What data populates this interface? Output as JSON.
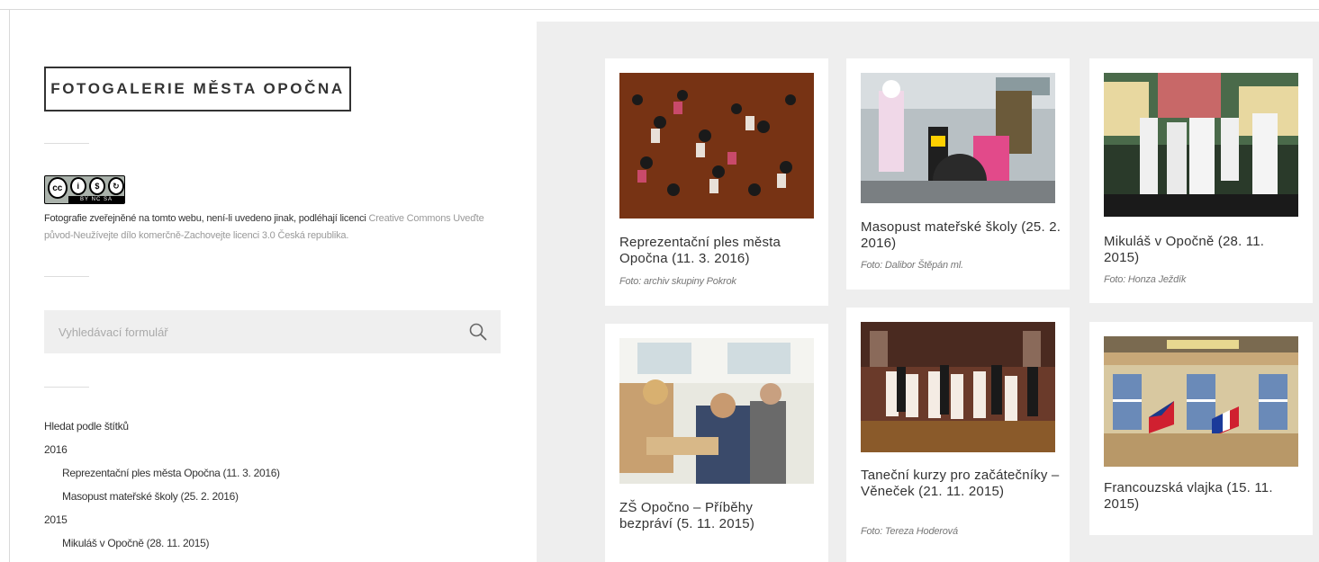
{
  "site": {
    "title": "FOTOGALERIE MĚSTA OPOČNA"
  },
  "license": {
    "badge_text": "BY NC SA",
    "text_prefix": "Fotografie zveřejněné na tomto webu, není-li uvedeno jinak, podléhají licenci ",
    "link_text": "Creative Commons Uveďte původ-Neužívejte dílo komerčně-Zachovejte licenci 3.0 Česká republika."
  },
  "search": {
    "placeholder": "Vyhledávací formulář"
  },
  "tags": {
    "heading": "Hledat podle štítků",
    "groups": [
      {
        "year": "2016",
        "items": [
          "Reprezentační ples města Opočna (11. 3. 2016)",
          "Masopust mateřské školy (25. 2. 2016)"
        ]
      },
      {
        "year": "2015",
        "items": [
          "Mikuláš v Opočně (28. 11. 2015)"
        ]
      }
    ]
  },
  "gallery": {
    "cards": [
      {
        "title": "Reprezentační ples města Opočna (11. 3. 2016)",
        "credit": "Foto: archiv skupiny Pokrok",
        "photo_icon": "ballroom-dance-photo"
      },
      {
        "title": "Masopust mateřské školy (25. 2. 2016)",
        "credit": "Foto: Dalibor Štěpán ml.",
        "photo_icon": "carnival-kids-photo"
      },
      {
        "title": "Mikuláš v Opočně (28. 11. 2015)",
        "credit": "Foto: Honza Ježdík",
        "photo_icon": "stage-performance-photo"
      },
      {
        "title": "ZŠ Opočno – Příběhy bezpráví (5. 11. 2015)",
        "credit": "",
        "photo_icon": "classroom-photo"
      },
      {
        "title": "Taneční kurzy pro začátečníky – Věneček (21. 11. 2015)",
        "credit": "Foto: Tereza Hoderová",
        "photo_icon": "dance-course-photo"
      },
      {
        "title": "Francouzská vlajka (15. 11. 2015)",
        "credit": "",
        "photo_icon": "town-hall-flags-photo"
      }
    ]
  },
  "colors": {
    "gallery_bg": "#eeeeee",
    "title_border": "#333333",
    "search_bg": "#efefef"
  }
}
